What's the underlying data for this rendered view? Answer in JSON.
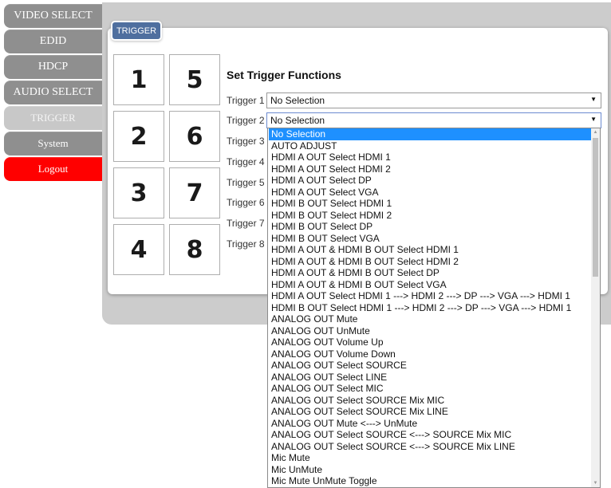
{
  "nav": {
    "items": [
      {
        "label": "VIDEO SELECT"
      },
      {
        "label": "EDID"
      },
      {
        "label": "HDCP"
      },
      {
        "label": "AUDIO SELECT"
      },
      {
        "label": "TRIGGER"
      },
      {
        "label": "System"
      },
      {
        "label": "Logout"
      }
    ]
  },
  "tab": {
    "label": "TRIGGER"
  },
  "buttons": [
    "1",
    "5",
    "2",
    "6",
    "3",
    "7",
    "4",
    "8"
  ],
  "heading": "Set Trigger Functions",
  "triggers": [
    {
      "label": "Trigger 1",
      "value": "No Selection"
    },
    {
      "label": "Trigger 2",
      "value": "No Selection"
    },
    {
      "label": "Trigger 3"
    },
    {
      "label": "Trigger 4"
    },
    {
      "label": "Trigger 5"
    },
    {
      "label": "Trigger 6"
    },
    {
      "label": "Trigger 7"
    },
    {
      "label": "Trigger 8"
    }
  ],
  "dropdown": {
    "selected": "No Selection",
    "options": [
      "No Selection",
      "AUTO ADJUST",
      "HDMI A OUT Select HDMI 1",
      "HDMI A OUT Select HDMI 2",
      "HDMI A OUT Select DP",
      "HDMI A OUT Select VGA",
      "HDMI B OUT Select HDMI 1",
      "HDMI B OUT Select HDMI 2",
      "HDMI B OUT Select DP",
      "HDMI B OUT Select VGA",
      "HDMI A OUT & HDMI B OUT Select HDMI 1",
      "HDMI A OUT & HDMI B OUT Select HDMI 2",
      "HDMI A OUT & HDMI B OUT Select DP",
      "HDMI A OUT & HDMI B OUT Select VGA",
      "HDMI A OUT Select HDMI 1 ---> HDMI 2 ---> DP ---> VGA ---> HDMI 1",
      "HDMI B OUT Select HDMI 1 ---> HDMI 2 ---> DP ---> VGA ---> HDMI 1",
      "ANALOG OUT Mute",
      "ANALOG OUT UnMute",
      "ANALOG OUT Volume Up",
      "ANALOG OUT Volume Down",
      "ANALOG OUT Select SOURCE",
      "ANALOG OUT Select LINE",
      "ANALOG OUT Select MIC",
      "ANALOG OUT Select SOURCE Mix MIC",
      "ANALOG OUT Select SOURCE Mix LINE",
      "ANALOG OUT Mute <---> UnMute",
      "ANALOG OUT Select SOURCE <---> SOURCE Mix MIC",
      "ANALOG OUT Select SOURCE <---> SOURCE Mix LINE",
      "Mic Mute",
      "Mic UnMute",
      "Mic Mute UnMute Toggle"
    ]
  },
  "colors": {
    "nav_bg": "#8f8f8f",
    "nav_active": "#c8c8c8",
    "logout": "#ff0000",
    "tab": "#4f6f9f",
    "highlight": "#1e90ff"
  }
}
